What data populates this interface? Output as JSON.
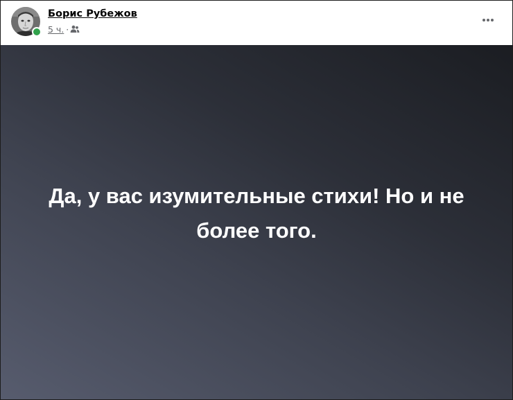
{
  "post": {
    "author": {
      "name": "Борис Рубежов",
      "online": true
    },
    "meta": {
      "timestamp": "5 ч.",
      "separator": "·",
      "audience_icon": "friends-icon"
    },
    "menu_icon": "more-options-icon",
    "text": "Да, у вас изумительные стихи! Но и не более того.",
    "colors": {
      "online_dot": "#31a24c",
      "background_start": "#575c6e",
      "background_end": "#1b1d22",
      "text": "#ffffff"
    }
  }
}
